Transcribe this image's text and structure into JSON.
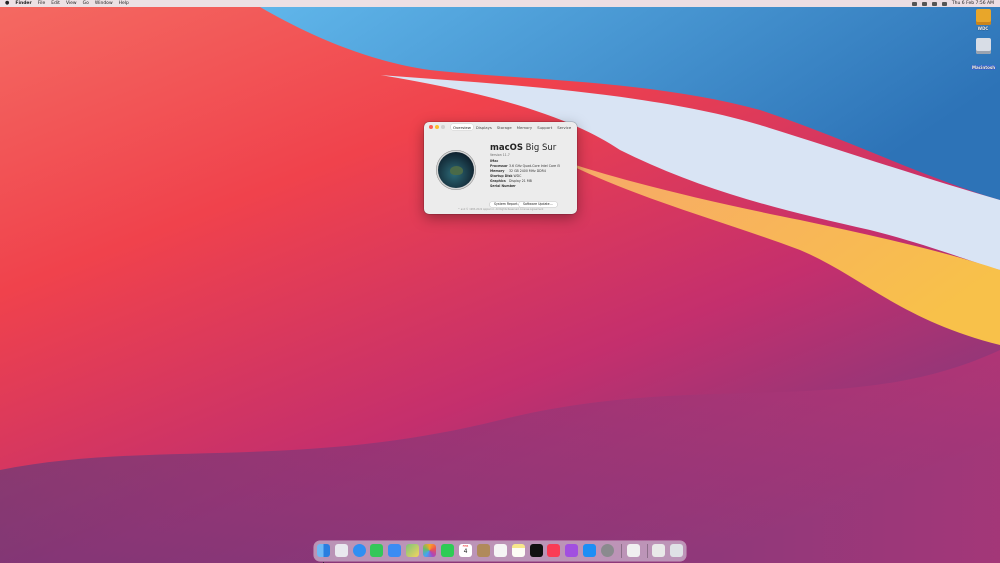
{
  "menubar": {
    "app_name": "Finder",
    "menus": [
      "File",
      "Edit",
      "View",
      "Go",
      "Window",
      "Help"
    ],
    "clock": "Thu 6 Feb 7:56 AM"
  },
  "desktop": {
    "icons": [
      {
        "label": "WDC",
        "icon": "hard-drive-icon",
        "color": "#e8a62a"
      },
      {
        "label": "Macintosh",
        "icon": "internal-disk-icon",
        "color": "#d8dde6"
      }
    ]
  },
  "window": {
    "tabs": [
      "Overview",
      "Displays",
      "Storage",
      "Memory",
      "Support",
      "Service"
    ],
    "active_tab": "Overview",
    "os_name_bold": "macOS",
    "os_name_light": " Big Sur",
    "version": "Version 11.7",
    "specs": [
      {
        "label": "iMac",
        "value": ""
      },
      {
        "label": "Processor",
        "value": "3.6 GHz Quad-Core Intel Core i5"
      },
      {
        "label": "Memory",
        "value": "32 GB 2400 MHz DDR4"
      },
      {
        "label": "Startup Disk",
        "value": "WDC"
      },
      {
        "label": "Graphics",
        "value": "Display 21 MB"
      },
      {
        "label": "Serial Number",
        "value": ""
      }
    ],
    "buttons": [
      "System Report...",
      "Software Update..."
    ],
    "copyright": "™ and © 1983-2022 Apple Inc. All Rights Reserved. License Agreement"
  },
  "dock": {
    "apps": [
      {
        "name": "finder-icon",
        "color": "#3c8fe8"
      },
      {
        "name": "launchpad-icon",
        "color": "#e9e9ef"
      },
      {
        "name": "safari-icon",
        "color": "#2f8ff2"
      },
      {
        "name": "messages-icon",
        "color": "#34c759"
      },
      {
        "name": "mail-icon",
        "color": "#3b8cf3"
      },
      {
        "name": "maps-icon",
        "color": "#7dc47a"
      },
      {
        "name": "photos-icon",
        "color": "#f4f4f4"
      },
      {
        "name": "facetime-icon",
        "color": "#2ecc55"
      },
      {
        "name": "calendar-icon",
        "color": "#ffffff"
      },
      {
        "name": "contacts-icon",
        "color": "#b08a5b"
      },
      {
        "name": "reminders-icon",
        "color": "#f5f5f5"
      },
      {
        "name": "notes-icon",
        "color": "#f7e78b"
      },
      {
        "name": "apple-tv-icon",
        "color": "#111111"
      },
      {
        "name": "music-icon",
        "color": "#fa3c55"
      },
      {
        "name": "podcasts-icon",
        "color": "#a24fe0"
      },
      {
        "name": "app-store-icon",
        "color": "#1d8ef5"
      },
      {
        "name": "system-preferences-icon",
        "color": "#8a8a8e"
      },
      {
        "name": "app-icon",
        "color": "#f0f0f0"
      },
      {
        "name": "preview-icon",
        "color": "#e9e9e9"
      },
      {
        "name": "trash-icon",
        "color": "#dfe2e6"
      }
    ],
    "calendar_month": "FEB",
    "calendar_day": "4"
  }
}
